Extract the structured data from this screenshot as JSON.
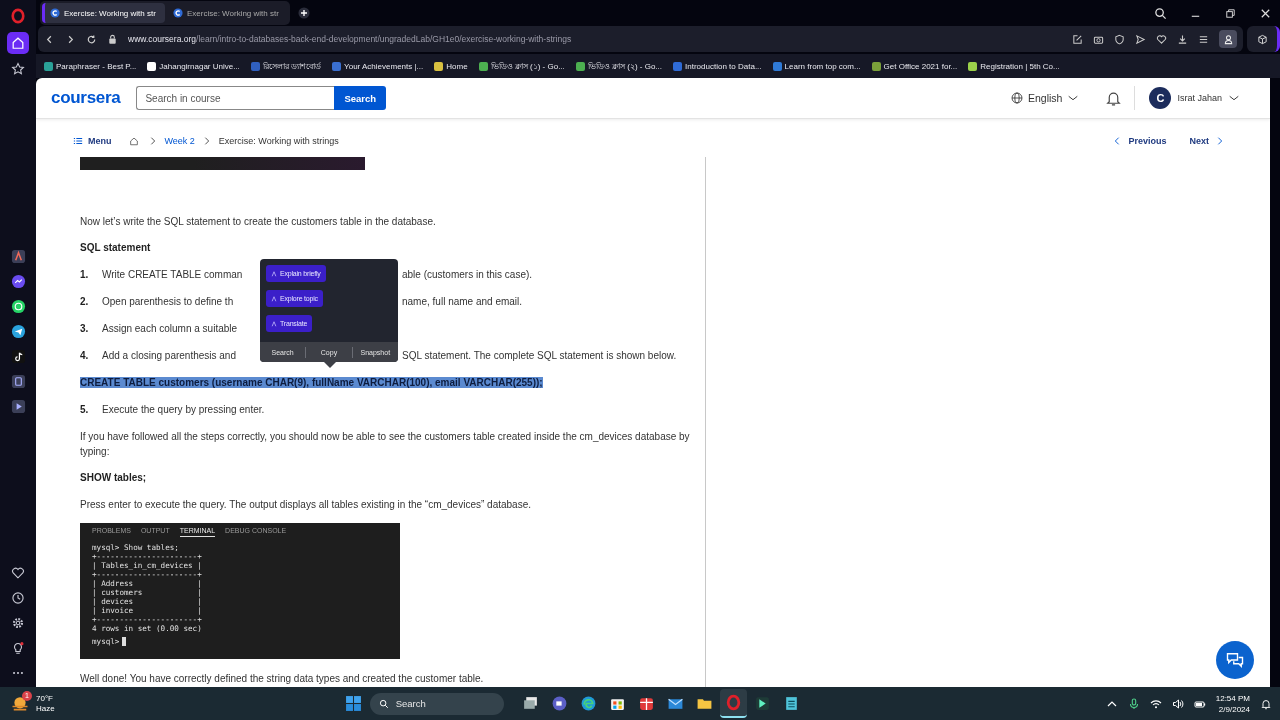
{
  "opera_sidebar": [
    {
      "kind": "home",
      "selected": true
    },
    {
      "kind": "star",
      "selected": false
    }
  ],
  "opera_apps": [
    {
      "kind": "aria"
    },
    {
      "kind": "messenger"
    },
    {
      "kind": "whatsapp"
    },
    {
      "kind": "telegram"
    },
    {
      "kind": "tiktok"
    },
    {
      "kind": "player"
    },
    {
      "kind": "play"
    }
  ],
  "opera_bottom": [
    {
      "kind": "heart"
    },
    {
      "kind": "history"
    },
    {
      "kind": "settings"
    },
    {
      "kind": "bulb"
    },
    {
      "kind": "more"
    }
  ],
  "browser": {
    "tabs": [
      {
        "title": "Exercise: Working with str",
        "selected": true
      },
      {
        "title": "Exercise: Working with str",
        "selected": false
      }
    ],
    "url_domain": "www.coursera.org",
    "url_path": "/learn/intro-to-databases-back-end-development/ungradedLab/GH1e0/exercise-working-with-strings",
    "bookmarks": [
      {
        "label": "Paraphraser - Best P...",
        "color": "#2aa198"
      },
      {
        "label": "Jahangirnagar Unive...",
        "color": "#ffffff"
      },
      {
        "label": "রিসেলার ড্যাশবোর্ড",
        "color": "#3060c0"
      },
      {
        "label": "Your Achievements |...",
        "color": "#3a6fd0"
      },
      {
        "label": "Home",
        "color": "#d8c040"
      },
      {
        "label": "ভিডিও ক্লাস (১) - Go...",
        "color": "#4caf50"
      },
      {
        "label": "ভিডিও ক্লাস (২) - Go...",
        "color": "#4caf50"
      },
      {
        "label": "Introduction to Data...",
        "color": "#2f6bd6"
      },
      {
        "label": "Learn from top com...",
        "color": "#2f7ad6"
      },
      {
        "label": "Get Office 2021 for...",
        "color": "#7aa03a"
      },
      {
        "label": "Registration | 5th Co...",
        "color": "#9bd14a"
      }
    ]
  },
  "header": {
    "logo": "coursera",
    "search_placeholder": "Search in course",
    "search_button": "Search",
    "language": "English",
    "avatar_letter": "C",
    "user": "Israt Jahan"
  },
  "breadcrumbs": {
    "menu": "Menu",
    "items": [
      "Week 2",
      "Exercise: Working with strings"
    ],
    "previous": "Previous",
    "next": "Next"
  },
  "content": [
    {
      "kind": "image_strip"
    },
    {
      "kind": "para",
      "text": "Now let’s write the SQL statement to create the customers table in the database."
    },
    {
      "kind": "heading",
      "text": "SQL statement"
    },
    {
      "kind": "step",
      "number": "1.",
      "text": "Write CREATE TABLE comman",
      "text_after": "able (customers in this case)."
    },
    {
      "kind": "step",
      "number": "2.",
      "text": "Open parenthesis to define th",
      "text_after": "name, full name and email."
    },
    {
      "kind": "step",
      "number": "3.",
      "text": "Assign each column a suitable"
    },
    {
      "kind": "step",
      "number": "4.",
      "text": "Add a closing parenthesis and",
      "text_after": "SQL statement. The complete SQL statement is shown below."
    },
    {
      "kind": "code",
      "text": "CREATE TABLE customers (username CHAR(9), fullName VARCHAR(100), email VARCHAR(255));",
      "selected": true
    },
    {
      "kind": "step",
      "number": "5.",
      "text": "Execute the query by pressing enter."
    },
    {
      "kind": "para",
      "text": "If you have followed all the steps correctly, you should now be able to see the customers table created inside the cm_devices database by typing:"
    },
    {
      "kind": "heading",
      "text": "SHOW tables;"
    },
    {
      "kind": "para",
      "text": "Press enter to execute the query. The output displays all tables existing in the “cm_devices” database."
    },
    {
      "kind": "terminal",
      "tabs": [
        {
          "label": "PROBLEMS",
          "selected": false
        },
        {
          "label": "OUTPUT",
          "selected": false
        },
        {
          "label": "TERMINAL",
          "selected": true
        },
        {
          "label": "DEBUG CONSOLE",
          "selected": false
        }
      ],
      "lines": [
        "mysql> Show tables;",
        "+----------------------+",
        "| Tables_in_cm_devices |",
        "+----------------------+",
        "| Address              |",
        "| customers            |",
        "| devices              |",
        "| invoice              |",
        "+----------------------+",
        "4 rows in set (0.00 sec)"
      ],
      "prompt": "mysql>"
    },
    {
      "kind": "para",
      "text": "Well done! You have correctly defined the string data types and created the customer table."
    }
  ],
  "popup": {
    "actions": [
      "Explain briefly",
      "Explore topic",
      "Translate"
    ],
    "tools": [
      "Search",
      "Copy",
      "Snapshot"
    ]
  },
  "taskbar": {
    "temperature": "70°F",
    "condition": "Haze",
    "badge": "1",
    "search_placeholder": "Search",
    "apps": [
      {
        "kind": "files",
        "selected": false
      },
      {
        "kind": "meet",
        "selected": false
      },
      {
        "kind": "edge",
        "selected": false
      },
      {
        "kind": "store",
        "selected": false
      },
      {
        "kind": "gift",
        "selected": false
      },
      {
        "kind": "mail",
        "selected": false
      },
      {
        "kind": "folder",
        "selected": false
      },
      {
        "kind": "opera",
        "selected": true
      },
      {
        "kind": "editor",
        "selected": false
      },
      {
        "kind": "notepad",
        "selected": false
      }
    ],
    "time": "12:54 PM",
    "date": "2/9/2024"
  }
}
